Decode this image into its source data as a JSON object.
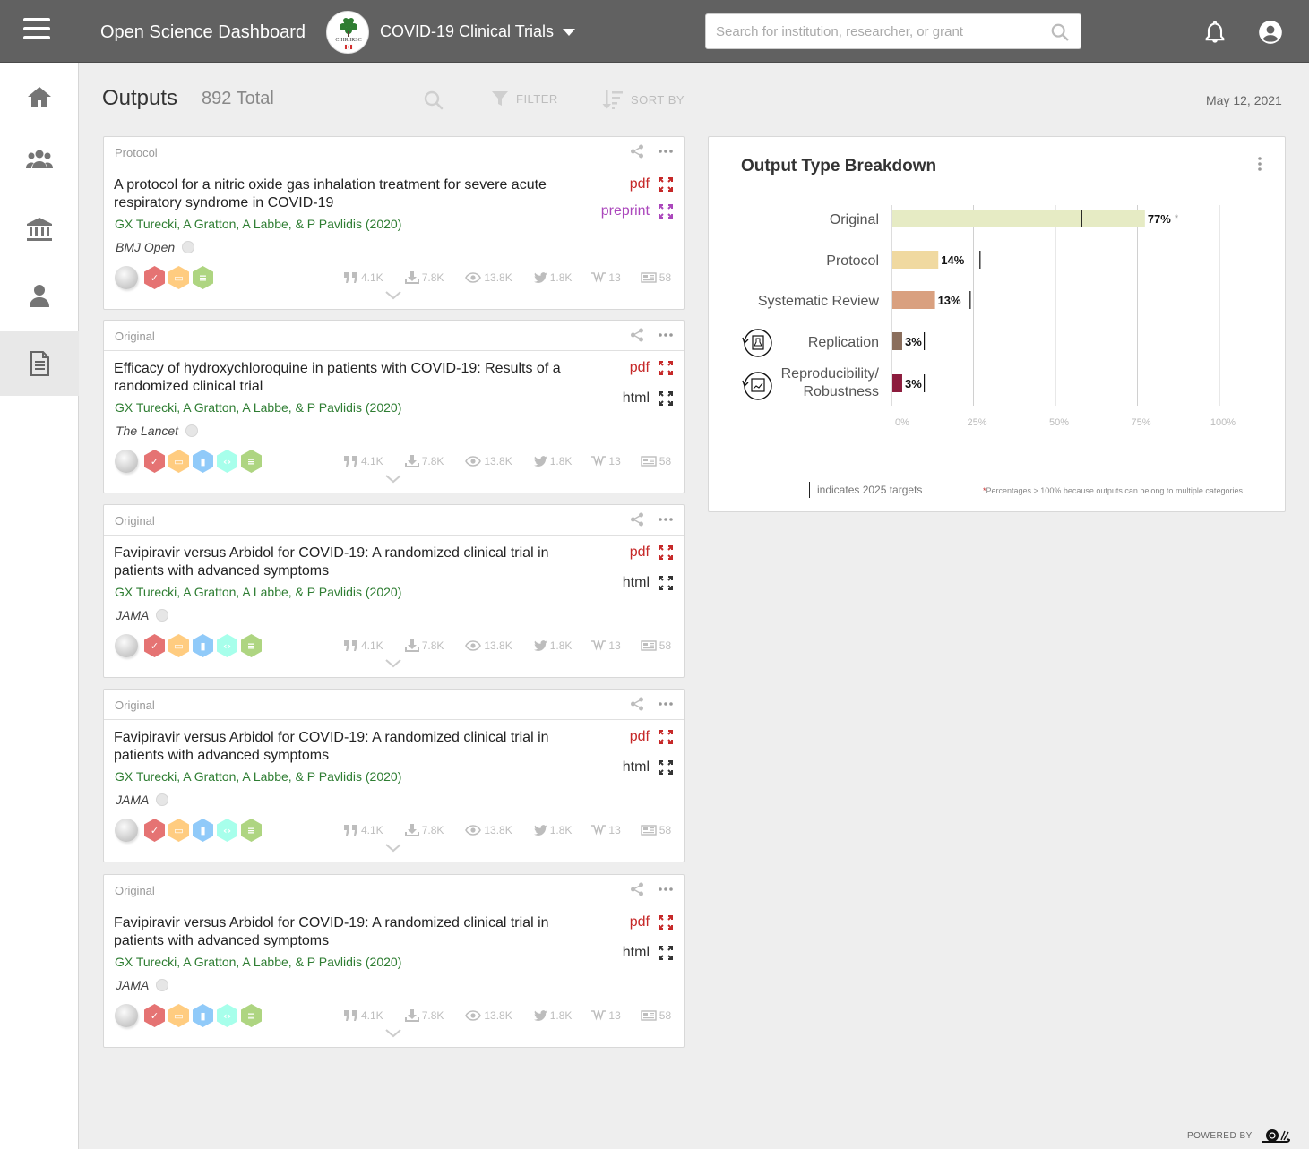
{
  "header": {
    "app_title": "Open Science Dashboard",
    "org_logo_text": "CIHR IRSC",
    "project": "COVID-19 Clinical Trials",
    "search_placeholder": "Search for institution, researcher, or grant",
    "icons": [
      "menu-icon",
      "search-icon",
      "bell-icon",
      "account-icon"
    ]
  },
  "sidebar": {
    "items": [
      {
        "name": "home",
        "icon": "home-icon",
        "active": false
      },
      {
        "name": "groups",
        "icon": "group-icon",
        "active": false
      },
      {
        "name": "institutions",
        "icon": "institution-icon",
        "active": false
      },
      {
        "name": "person",
        "icon": "person-icon",
        "active": false
      },
      {
        "name": "outputs",
        "icon": "document-icon",
        "active": true
      }
    ]
  },
  "content": {
    "title": "Outputs",
    "total": "892 Total",
    "filter_label": "FILTER",
    "sort_label": "SORT BY",
    "date": "May 12, 2021"
  },
  "outputs": [
    {
      "type": "Protocol",
      "title": "A protocol for a nitric oxide gas inhalation treatment for severe acute respiratory syndrome in COVID-19",
      "authors": "GX Turecki, A Gratton, A Labbe, & P Pavlidis (2020)",
      "journal": "BMJ Open",
      "links": [
        {
          "label": "pdf",
          "color": "#c62828",
          "icon_color": "#c62828"
        },
        {
          "label": "preprint",
          "color": "#ab47bc",
          "icon_color": "#ab47bc"
        }
      ],
      "badges": [
        "check",
        "box",
        "doc"
      ],
      "metrics": {
        "citations": "4.1K",
        "downloads": "7.8K",
        "views": "13.8K",
        "tweets": "1.8K",
        "wiki": "13",
        "news": "58"
      }
    },
    {
      "type": "Original",
      "title": "Efficacy of hydroxychloroquine in patients with COVID-19: Results of a randomized clinical trial",
      "authors": "GX Turecki, A Gratton, A Labbe, & P Pavlidis (2020)",
      "journal": "The Lancet",
      "links": [
        {
          "label": "pdf",
          "color": "#c62828",
          "icon_color": "#c62828"
        },
        {
          "label": "html",
          "color": "#333333",
          "icon_color": "#333333"
        }
      ],
      "badges": [
        "check",
        "box",
        "chart",
        "code",
        "doc"
      ],
      "metrics": {
        "citations": "4.1K",
        "downloads": "7.8K",
        "views": "13.8K",
        "tweets": "1.8K",
        "wiki": "13",
        "news": "58"
      }
    },
    {
      "type": "Original",
      "title": "Favipiravir versus Arbidol for COVID-19: A randomized clinical trial in patients with advanced symptoms",
      "authors": "GX Turecki, A Gratton, A Labbe, & P Pavlidis (2020)",
      "journal": "JAMA",
      "links": [
        {
          "label": "pdf",
          "color": "#c62828",
          "icon_color": "#c62828"
        },
        {
          "label": "html",
          "color": "#333333",
          "icon_color": "#333333"
        }
      ],
      "badges": [
        "check",
        "box",
        "chart",
        "code",
        "doc"
      ],
      "metrics": {
        "citations": "4.1K",
        "downloads": "7.8K",
        "views": "13.8K",
        "tweets": "1.8K",
        "wiki": "13",
        "news": "58"
      }
    },
    {
      "type": "Original",
      "title": "Favipiravir versus Arbidol for COVID-19: A randomized clinical trial in patients with advanced symptoms",
      "authors": "GX Turecki, A Gratton, A Labbe, & P Pavlidis (2020)",
      "journal": "JAMA",
      "links": [
        {
          "label": "pdf",
          "color": "#c62828",
          "icon_color": "#c62828"
        },
        {
          "label": "html",
          "color": "#333333",
          "icon_color": "#333333"
        }
      ],
      "badges": [
        "check",
        "box",
        "chart",
        "code",
        "doc"
      ],
      "metrics": {
        "citations": "4.1K",
        "downloads": "7.8K",
        "views": "13.8K",
        "tweets": "1.8K",
        "wiki": "13",
        "news": "58"
      }
    },
    {
      "type": "Original",
      "title": "Favipiravir versus Arbidol for COVID-19: A randomized clinical trial in patients with advanced symptoms",
      "authors": "GX Turecki, A Gratton, A Labbe, & P Pavlidis (2020)",
      "journal": "JAMA",
      "links": [
        {
          "label": "pdf",
          "color": "#c62828",
          "icon_color": "#c62828"
        },
        {
          "label": "html",
          "color": "#333333",
          "icon_color": "#333333"
        }
      ],
      "badges": [
        "check",
        "box",
        "chart",
        "code",
        "doc"
      ],
      "metrics": {
        "citations": "4.1K",
        "downloads": "7.8K",
        "views": "13.8K",
        "tweets": "1.8K",
        "wiki": "13",
        "news": "58"
      }
    }
  ],
  "badge_colors": {
    "check": "#e57373",
    "box": "#ffcc80",
    "chart": "#90caf9",
    "code": "#a7ffeb",
    "doc": "#aed581"
  },
  "chart_data": {
    "type": "bar",
    "orientation": "horizontal",
    "title": "Output Type Breakdown",
    "categories": [
      "Original",
      "Protocol",
      "Systematic Review",
      "Replication",
      "Reproducibility/ Robustness"
    ],
    "values": [
      77,
      14,
      13,
      3,
      3
    ],
    "value_labels": [
      "77%",
      "14%",
      "13%",
      "3%",
      "3%"
    ],
    "targets": [
      58,
      27,
      24,
      10,
      10
    ],
    "colors": [
      "#e6ebc4",
      "#f0d9a0",
      "#d9a07f",
      "#8a6e5c",
      "#8c1c3d"
    ],
    "xlim": [
      0,
      100
    ],
    "xticks": [
      "0%",
      "25%",
      "50%",
      "75%",
      "100%"
    ],
    "grid": true,
    "asterisk_on": "Original",
    "target_legend": "indicates 2025 targets",
    "footnote": "Percentages > 100% because outputs can belong to multiple categories"
  },
  "footer": {
    "powered_by": "POWERED BY"
  }
}
